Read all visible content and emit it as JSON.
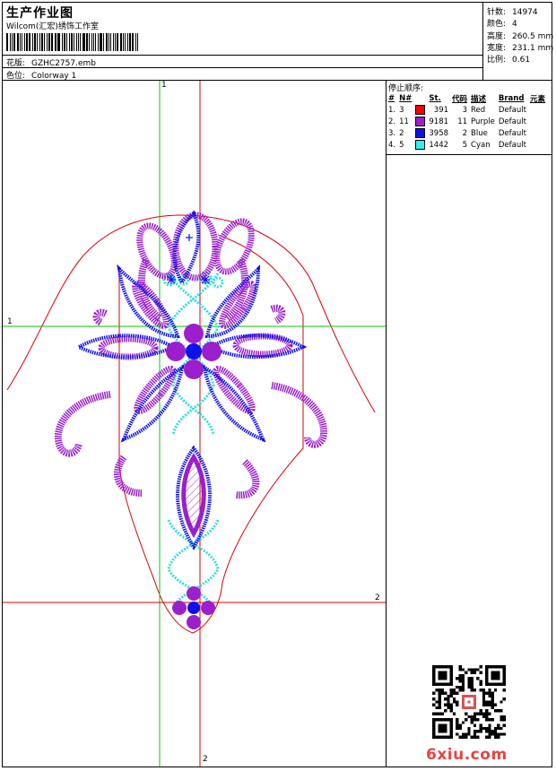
{
  "header": {
    "title": "生产作业图",
    "company": "Wilcom(汇宏)绣饰工作室",
    "design_label": "花版:",
    "design_value": "GZHC2757.emb",
    "colorway_label": "色位:",
    "colorway_value": "Colorway 1"
  },
  "stats": [
    {
      "label": "针数:",
      "value": "14974"
    },
    {
      "label": "颜色:",
      "value": "4"
    },
    {
      "label": "高度:",
      "value": "260.5 mm"
    },
    {
      "label": "宽度:",
      "value": "231.1 mm"
    },
    {
      "label": "比例:",
      "value": "0.61"
    }
  ],
  "stop_sequence": {
    "title": "停止顺序:",
    "columns": [
      "#",
      "N#",
      "St.",
      "代码",
      "描述",
      "Brand",
      "元素"
    ],
    "rows": [
      {
        "num": "1.",
        "n": "3",
        "color": "#ff0000",
        "st": "391",
        "code": "3",
        "desc": "Red",
        "brand": "Default"
      },
      {
        "num": "2.",
        "n": "11",
        "color": "#9b1fcc",
        "st": "9181",
        "code": "11",
        "desc": "Purple",
        "brand": "Default"
      },
      {
        "num": "3.",
        "n": "2",
        "color": "#1010e8",
        "st": "3958",
        "code": "2",
        "desc": "Blue",
        "brand": "Default"
      },
      {
        "num": "4.",
        "n": "5",
        "color": "#33eeee",
        "st": "1442",
        "code": "5",
        "desc": "Cyan",
        "brand": "Default"
      }
    ]
  },
  "axes": {
    "v1": "1",
    "h1": "1",
    "h2": "2",
    "v2": "2"
  },
  "watermark": "6xiu.com",
  "colors": {
    "red": "#ff0000",
    "purple": "#9b1fcc",
    "blue": "#1010e8",
    "cyan": "#33dddd",
    "green_guide": "#00cc00",
    "red_guide": "#dd0000"
  }
}
